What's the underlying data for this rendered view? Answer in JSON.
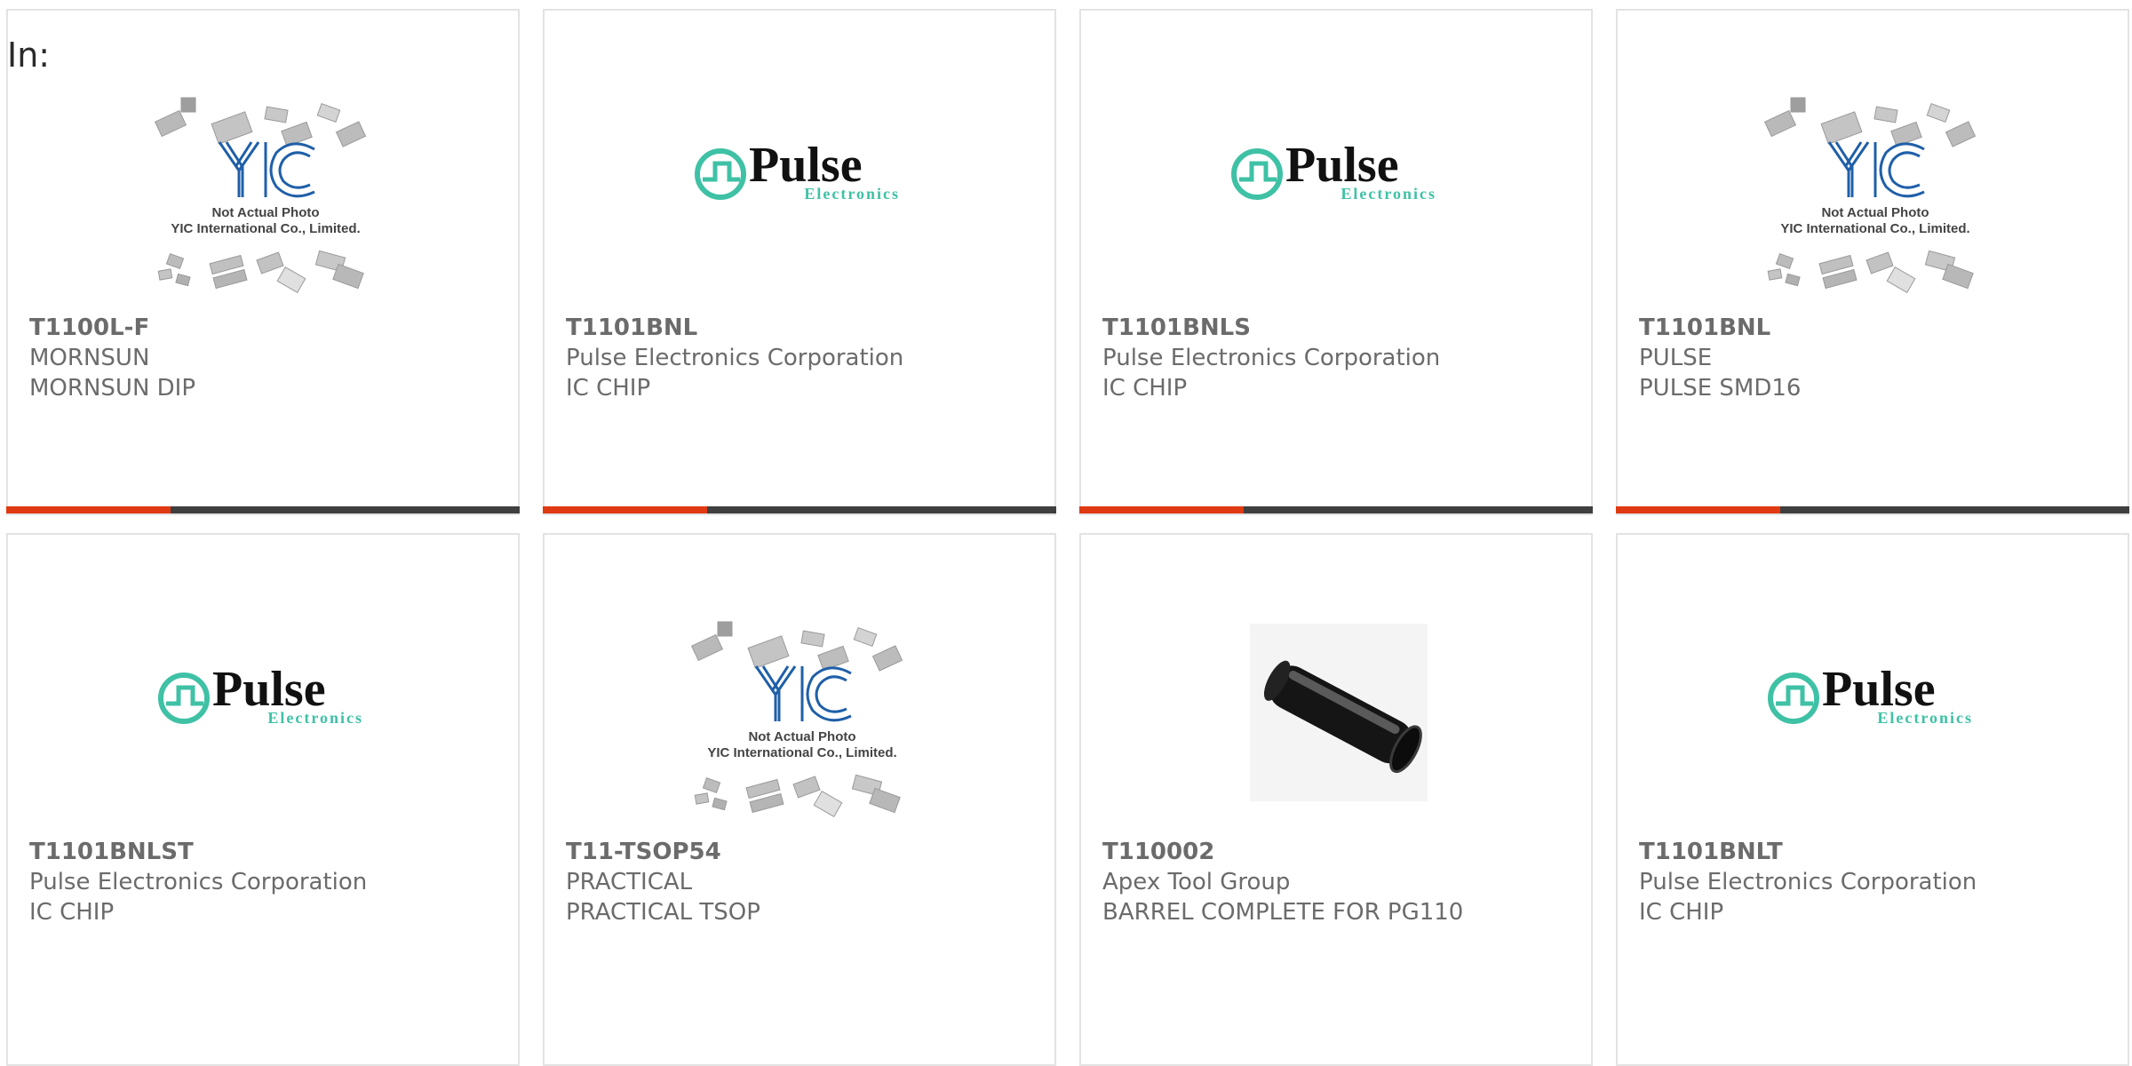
{
  "filter_label": "In:",
  "accent_color": "#e03a12",
  "bar_color": "#3f3f3f",
  "products": [
    {
      "part_number": "T1100L-F",
      "manufacturer": "MORNSUN",
      "description": "MORNSUN DIP",
      "image": "yic-placeholder",
      "image_text": [
        "Not Actual Photo",
        "YIC International Co., Limited."
      ],
      "progress": 0.32
    },
    {
      "part_number": "T1101BNL",
      "manufacturer": "Pulse Electronics Corporation",
      "description": "IC CHIP",
      "image": "pulse-logo",
      "image_text": [
        "Pulse",
        "Electronics"
      ],
      "progress": 0.32
    },
    {
      "part_number": "T1101BNLS",
      "manufacturer": "Pulse Electronics Corporation",
      "description": "IC CHIP",
      "image": "pulse-logo",
      "image_text": [
        "Pulse",
        "Electronics"
      ],
      "progress": 0.32
    },
    {
      "part_number": "T1101BNL",
      "manufacturer": "PULSE",
      "description": "PULSE SMD16",
      "image": "yic-placeholder",
      "image_text": [
        "Not Actual Photo",
        "YIC International Co., Limited."
      ],
      "progress": 0.32
    },
    {
      "part_number": "T1101BNLST",
      "manufacturer": "Pulse Electronics Corporation",
      "description": "IC CHIP",
      "image": "pulse-logo",
      "image_text": [
        "Pulse",
        "Electronics"
      ]
    },
    {
      "part_number": "T11-TSOP54",
      "manufacturer": "PRACTICAL",
      "description": "PRACTICAL TSOP",
      "image": "yic-placeholder",
      "image_text": [
        "Not Actual Photo",
        "YIC International Co., Limited."
      ]
    },
    {
      "part_number": "T110002",
      "manufacturer": "Apex Tool Group",
      "description": "BARREL COMPLETE FOR PG110",
      "image": "barrel-photo"
    },
    {
      "part_number": "T1101BNLT",
      "manufacturer": "Pulse Electronics Corporation",
      "description": "IC CHIP",
      "image": "pulse-logo",
      "image_text": [
        "Pulse",
        "Electronics"
      ]
    }
  ]
}
